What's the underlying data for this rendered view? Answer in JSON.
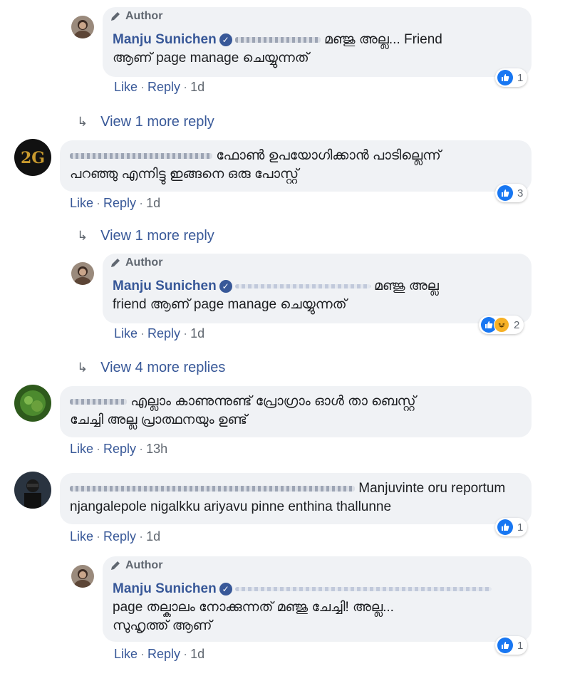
{
  "labels": {
    "author": "Author",
    "like": "Like",
    "reply": "Reply"
  },
  "thread": {
    "reply1": {
      "name": "Manju Sunichen",
      "line1": "മഞ്ജു അല്ല... Friend",
      "line2": "ആണ് page manage ചെയ്യുന്നത്",
      "time": "1d",
      "reactions": "1"
    },
    "more1": "View 1 more reply",
    "comment1": {
      "line1": "ഫോൺ ഉപയോഗിക്കാൻ പാടില്ലെന്ന്",
      "line2": "പറഞ്ഞു എന്നിട്ടു ഇങ്ങനെ ഒരു പോസ്റ്റ്",
      "time": "1d",
      "reactions": "3"
    },
    "more2": "View 1 more reply",
    "reply2": {
      "name": "Manju Sunichen",
      "line1": "മഞ്ജു അല്ല",
      "line2": "friend ആണ് page manage ചെയ്യുന്നത്",
      "time": "1d",
      "reactions": "2"
    },
    "more3": "View 4 more replies",
    "comment2": {
      "line1": "എല്ലാം കാണുന്നുണ്ട് പ്രോഗ്രാം ഓൾ താ ബെസ്റ്റ്",
      "line2": "ചേച്ചി അല്ല പ്രാത്ഥനയും ഉണ്ട്",
      "time": "13h"
    },
    "comment3": {
      "line1": "Manjuvinte oru reportum",
      "line2": "njangalepole nigalkku ariyavu pinne enthina thallunne",
      "time": "1d",
      "reactions": "1"
    },
    "reply3": {
      "name": "Manju Sunichen",
      "line2": "page തല്കാലം നോക്കുന്നത് മഞ്ജു ചേച്ചി! അല്ല...",
      "line3": "സുഹൃത്ത് ആണ്",
      "time": "1d",
      "reactions": "1"
    }
  }
}
